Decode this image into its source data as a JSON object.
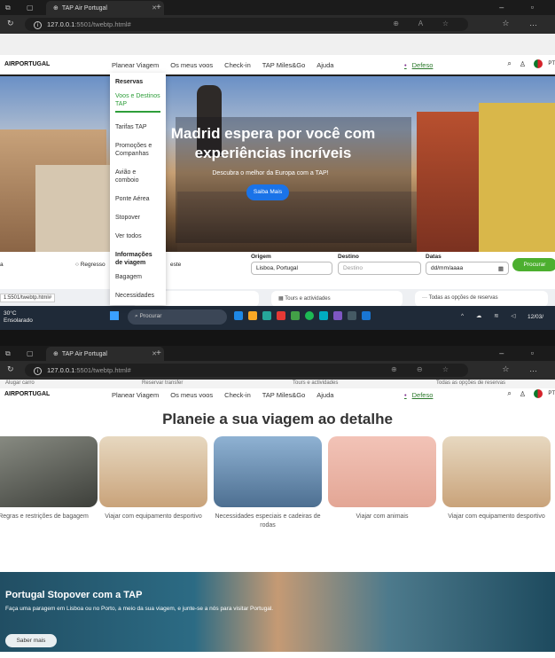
{
  "browser": {
    "tab_title": "TAP Air Portugal",
    "url_host": "127.0.0.1",
    "url_rest": ":5501/twebtp.html#",
    "status_url": "1:5501/twebtp.html#"
  },
  "header": {
    "logo_text": "AIRPORTUGAL",
    "logo_mark": "",
    "nav": [
      "Planear Viagem",
      "Os meus voos",
      "Check-in",
      "TAP Miles&Go",
      "Ajuda"
    ],
    "defeso": "Defeso",
    "lang": "PT"
  },
  "dropdown": {
    "section1": "Reservas",
    "items1": [
      "Voos e Destinos TAP",
      "Tarifas TAP",
      "Promoções e Companhas",
      "Avião e comboio",
      "Ponte Aérea",
      "Stopover",
      "Ver todos"
    ],
    "section2": "Informações de viagem",
    "items2": [
      "Bagagem",
      "Necessidades"
    ]
  },
  "hero": {
    "title": "Madrid espera por você com experiências incríveis",
    "subtitle": "Descubra o melhor da Europa com a TAP!",
    "cta": "Saiba Mais"
  },
  "booking": {
    "trip_a": "a",
    "trip_return": "Regresso",
    "trip_multi": "este",
    "origin_label": "Origem",
    "origin_value": "Lisboa, Portugal",
    "dest_label": "Destino",
    "dest_placeholder": "Destino",
    "dates_label": "Datas",
    "dates_value": "dd/mm/aaaa",
    "search_button": "Procurar"
  },
  "quick_links": [
    "transfer",
    "Tours e actividades",
    "Todas as opções de reservas"
  ],
  "taskbar": {
    "temp": "30°C",
    "weather": "Ensolarado",
    "search": "Procurar",
    "date": "12/03/"
  },
  "screen2": {
    "peek_links": [
      "Alugar carro",
      "Reservar transfer",
      "Tours e actividades",
      "Todas as opções de reservas"
    ],
    "section_title": "Planeie a sua viagem ao detalhe",
    "cards": [
      {
        "caption": "Regras e restrições de bagagem",
        "color": "#6b6f67"
      },
      {
        "caption": "Viajar com equipamento desportivo",
        "color": "#c9b08c"
      },
      {
        "caption": "Necessidades especiais e cadeiras de rodas",
        "color": "#5b7fa3"
      },
      {
        "caption": "Viajar com animais",
        "color": "#e9b5a8"
      },
      {
        "caption": "Viajar com equipamento desportivo",
        "color": "#c9b08c"
      }
    ],
    "promo_title": "Portugal Stopover com a TAP",
    "promo_text": "Faça uma paragem em Lisboa ou no Porto, a meio da sua viagem, e junte-se a nós para visitar Portugal.",
    "promo_button": "Saber mais"
  },
  "colors": {
    "brand_red": "#d2242a",
    "green": "#4caf2f",
    "blue": "#1a73e8"
  }
}
